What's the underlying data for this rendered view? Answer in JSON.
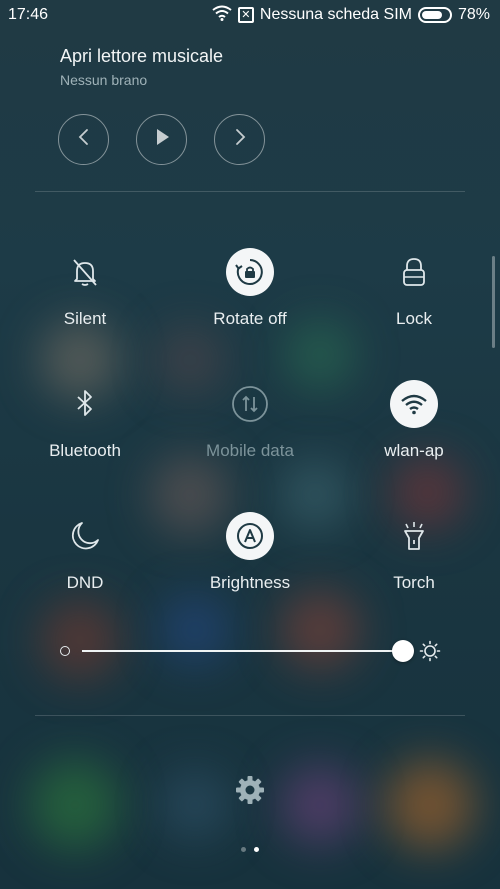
{
  "status_bar": {
    "time": "17:46",
    "carrier": "Nessuna scheda SIM",
    "battery_text": "78%",
    "battery_level": 0.78,
    "icons": [
      "wifi-icon",
      "no-sim-icon",
      "battery-icon"
    ]
  },
  "music": {
    "title": "Apri lettore musicale",
    "subtitle": "Nessun brano",
    "controls": [
      "previous-icon",
      "play-icon",
      "next-icon"
    ]
  },
  "toggles": [
    {
      "label": "Silent",
      "icon": "bell-off-icon",
      "active": false,
      "disabled": false
    },
    {
      "label": "Rotate off",
      "icon": "rotate-lock-icon",
      "active": true,
      "disabled": false
    },
    {
      "label": "Lock",
      "icon": "lock-icon",
      "active": false,
      "disabled": false
    },
    {
      "label": "Bluetooth",
      "icon": "bluetooth-icon",
      "active": false,
      "disabled": false
    },
    {
      "label": "Mobile data",
      "icon": "mobile-data-icon",
      "active": false,
      "disabled": true
    },
    {
      "label": "wlan-ap",
      "icon": "wifi-icon",
      "active": true,
      "disabled": false
    },
    {
      "label": "DND",
      "icon": "moon-icon",
      "active": false,
      "disabled": false
    },
    {
      "label": "Brightness",
      "icon": "auto-brightness-icon",
      "active": true,
      "disabled": false
    },
    {
      "label": "Torch",
      "icon": "flashlight-icon",
      "active": false,
      "disabled": false
    }
  ],
  "brightness": {
    "level": 1.0,
    "min_icon": "brightness-low-icon",
    "max_icon": "brightness-high-icon"
  },
  "footer": {
    "settings_icon": "gear-icon",
    "pages": 2,
    "current_page": 2
  },
  "colors": {
    "active_toggle_bg": "#f4f6f7",
    "active_icon": "#1f3a44",
    "icon_default": "#dfe7ea",
    "icon_disabled": "#7c939a"
  }
}
